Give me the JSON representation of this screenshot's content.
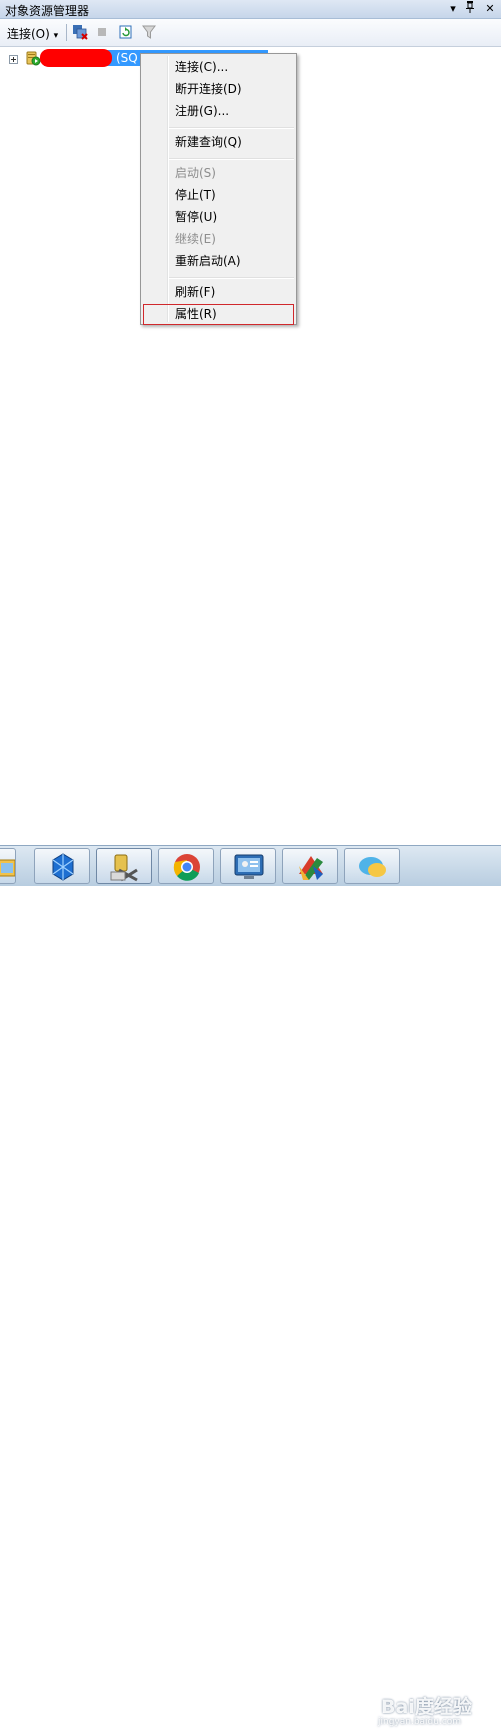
{
  "window": {
    "title": "对象资源管理器",
    "controls": {
      "dropdown": "▾",
      "pin": "ᛘ",
      "close": "✕"
    }
  },
  "toolbar": {
    "connect_label": "连接(O)",
    "dropdown_arrow": "▾",
    "icons": [
      "connect-object-explorer-icon",
      "disconnect-icon",
      "stop-icon",
      "refresh-icon",
      "filter-icon"
    ]
  },
  "tree": {
    "server_node": {
      "suffix": "(SQ",
      "icon": "database-server-icon",
      "selected": true
    }
  },
  "context_menu": {
    "groups": [
      [
        {
          "label": "连接(C)...",
          "enabled": true
        },
        {
          "label": "断开连接(D)",
          "enabled": true
        },
        {
          "label": "注册(G)...",
          "enabled": true
        }
      ],
      [
        {
          "label": "新建查询(Q)",
          "enabled": true
        }
      ],
      [
        {
          "label": "启动(S)",
          "enabled": false
        },
        {
          "label": "停止(T)",
          "enabled": true
        },
        {
          "label": "暂停(U)",
          "enabled": true
        },
        {
          "label": "继续(E)",
          "enabled": false
        },
        {
          "label": "重新启动(A)",
          "enabled": true
        }
      ],
      [
        {
          "label": "刷新(F)",
          "enabled": true
        },
        {
          "label": "属性(R)",
          "enabled": true,
          "highlighted": true
        }
      ]
    ],
    "highlight_color": "#d0282c"
  },
  "taskbar": {
    "apps": [
      "explorer-icon",
      "visual-studio-icon",
      "sql-server-tools-icon",
      "chrome-icon",
      "remote-desktop-icon",
      "pinned-app-icon",
      "messenger-icon"
    ],
    "active_index": 2
  },
  "watermark": {
    "big": "Bai度经验",
    "small": "jingyan.baidu.com"
  },
  "colors": {
    "selection": "#3399ff",
    "redaction": "#ff0000"
  }
}
